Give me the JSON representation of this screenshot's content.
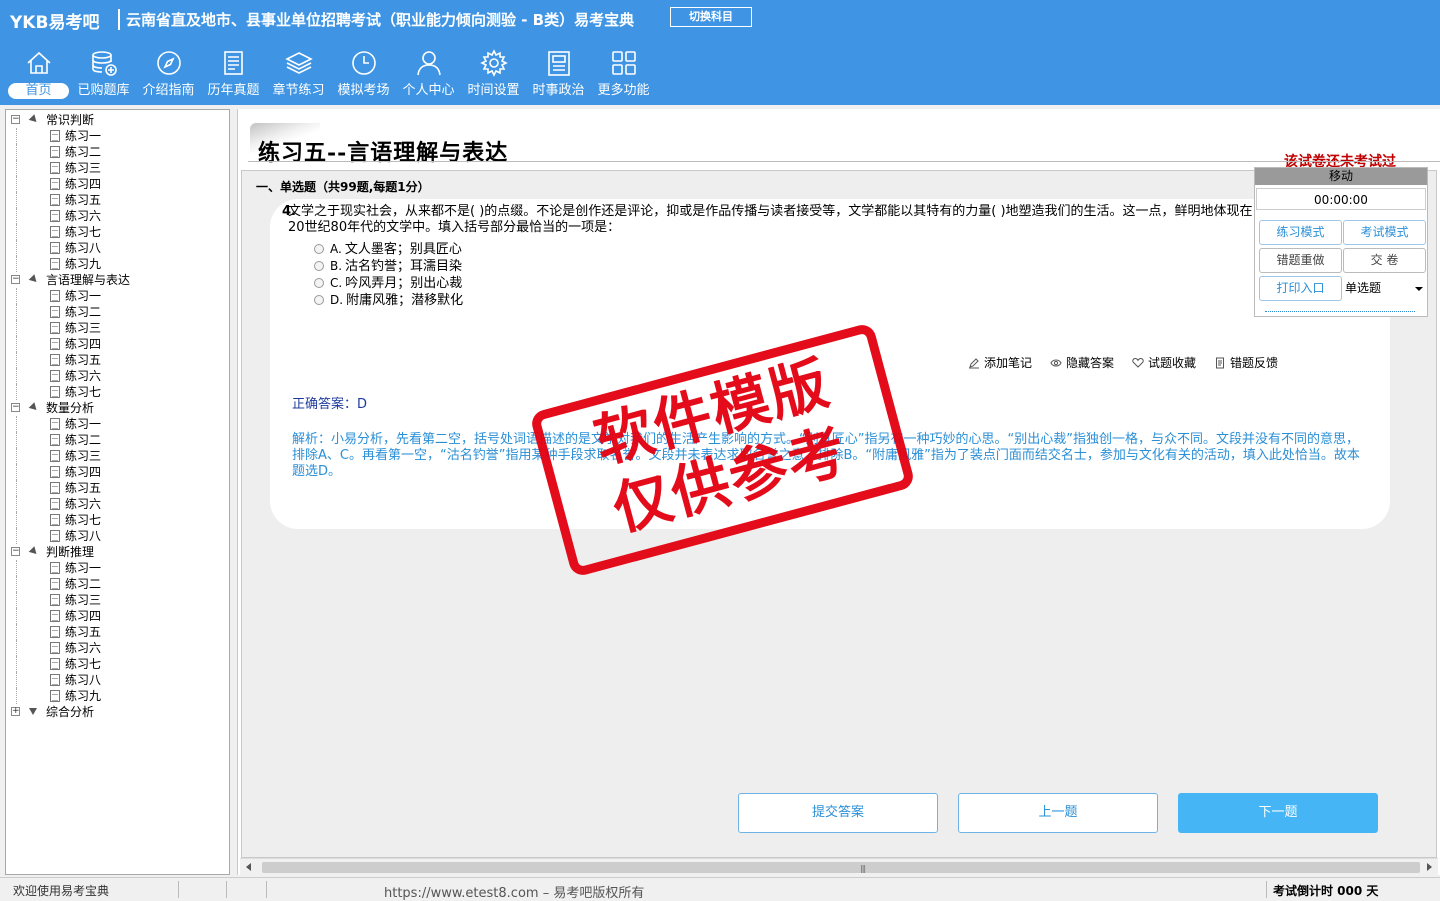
{
  "header": {
    "logo": "YKB易考吧",
    "title": "云南省直及地市、县事业单位招聘考试（职业能力倾向测验 - B类）易考宝典",
    "switch_label": "切换科目",
    "nav": [
      {
        "label": "首页",
        "icon": "home-icon"
      },
      {
        "label": "已购题库",
        "icon": "database-icon"
      },
      {
        "label": "介绍指南",
        "icon": "compass-icon"
      },
      {
        "label": "历年真题",
        "icon": "document-icon"
      },
      {
        "label": "章节练习",
        "icon": "layers-icon"
      },
      {
        "label": "模拟考场",
        "icon": "clock-icon"
      },
      {
        "label": "个人中心",
        "icon": "user-icon"
      },
      {
        "label": "时间设置",
        "icon": "gear-icon"
      },
      {
        "label": "时事政治",
        "icon": "newspaper-icon"
      },
      {
        "label": "更多功能",
        "icon": "grid-icon"
      }
    ]
  },
  "tree": [
    {
      "label": "常识判断",
      "expanded": true,
      "items": [
        "练习一",
        "练习二",
        "练习三",
        "练习四",
        "练习五",
        "练习六",
        "练习七",
        "练习八",
        "练习九"
      ]
    },
    {
      "label": "言语理解与表达",
      "expanded": true,
      "items": [
        "练习一",
        "练习二",
        "练习三",
        "练习四",
        "练习五",
        "练习六",
        "练习七"
      ]
    },
    {
      "label": "数量分析",
      "expanded": true,
      "items": [
        "练习一",
        "练习二",
        "练习三",
        "练习四",
        "练习五",
        "练习六",
        "练习七",
        "练习八"
      ]
    },
    {
      "label": "判断推理",
      "expanded": true,
      "items": [
        "练习一",
        "练习二",
        "练习三",
        "练习四",
        "练习五",
        "练习六",
        "练习七",
        "练习八",
        "练习九"
      ]
    },
    {
      "label": "综合分析",
      "expanded": false,
      "items": []
    }
  ],
  "exam": {
    "title": "练习五--言语理解与表达",
    "status": "该试卷还未考试过",
    "section": "一、单选题（共99题,每题1分）",
    "question_number": "4.",
    "question_text": "文学之于现实社会，从来都不是(  )的点缀。不论是创作还是评论，抑或是作品传播与读者接受等，文学都能以其特有的力量(  )地塑造我们的生活。这一点，鲜明地体现在20世纪80年代的文学中。填入括号部分最恰当的一项是：",
    "options": [
      {
        "letter": "A.",
        "text": "文人墨客；别具匠心"
      },
      {
        "letter": "B.",
        "text": "沽名钓誉；耳濡目染"
      },
      {
        "letter": "C.",
        "text": "吟风弄月；别出心裁"
      },
      {
        "letter": "D.",
        "text": "附庸风雅；潜移默化"
      }
    ],
    "tools": [
      {
        "label": "添加笔记",
        "icon": "pencil-icon"
      },
      {
        "label": "隐藏答案",
        "icon": "eye-icon"
      },
      {
        "label": "试题收藏",
        "icon": "heart-icon"
      },
      {
        "label": "错题反馈",
        "icon": "feedback-icon"
      }
    ],
    "answer": "正确答案：D",
    "analysis": "解析：小易分析，先看第二空，括号处词语描述的是文学对我们的生活产生影响的方式。“别具匠心”指另有一种巧妙的心思。“别出心裁”指独创一格，与众不同。文段并没有不同的意思，排除A、C。再看第一空，“沽名钓誉”指用某种手段求取名誉。文段并未表达求取名誉之意，排除B。“附庸风雅”指为了装点门面而结交名士，参加与文化有关的活动，填入此处恰当。故本题选D。"
  },
  "stamp": {
    "line1": "软件模版",
    "line2": "仅供参考",
    "color": "#e3000f"
  },
  "control": {
    "move": "移动",
    "timer": "00:00:00",
    "practice_mode": "练习模式",
    "exam_mode": "考试模式",
    "redo_wrong": "错题重做",
    "submit_paper": "交    卷",
    "print": "打印入口",
    "question_type": "单选题"
  },
  "buttons": {
    "submit": "提交答案",
    "prev": "上一题",
    "next": "下一题"
  },
  "statusbar": {
    "welcome": "欢迎使用易考宝典",
    "copyright": "https://www.etest8.com – 易考吧版权所有",
    "countdown": "考试倒计时 000 天"
  },
  "colors": {
    "header": "#3f95e3",
    "accent": "#2b8fd6",
    "status_red": "#c00000",
    "primary_button": "#45b5f5"
  }
}
